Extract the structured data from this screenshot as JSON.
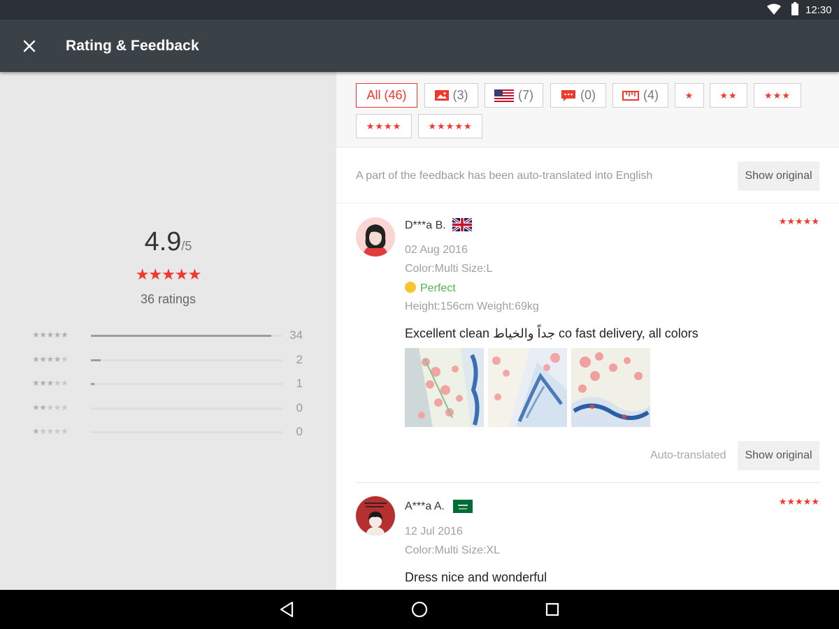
{
  "status_bar": {
    "time": "12:30",
    "icons": [
      "wifi-icon",
      "battery-icon"
    ]
  },
  "app_bar": {
    "title": "Rating & Feedback",
    "close_icon": "close-icon"
  },
  "summary": {
    "average": "4.9",
    "out_of": "/5",
    "stars": "★★★★★",
    "ratings_label": "36 ratings",
    "distribution": [
      {
        "stars": 5,
        "count": "34",
        "fraction": 0.94
      },
      {
        "stars": 4,
        "count": "2",
        "fraction": 0.05
      },
      {
        "stars": 3,
        "count": "1",
        "fraction": 0.02
      },
      {
        "stars": 2,
        "count": "0",
        "fraction": 0
      },
      {
        "stars": 1,
        "count": "0",
        "fraction": 0
      }
    ]
  },
  "filters": {
    "all": "All (46)",
    "photo_count": "(3)",
    "country_count": "(7)",
    "comment_count": "(0)",
    "size_count": "(4)",
    "one_star": "★",
    "two_star": "★★",
    "three_star": "★★★",
    "four_star": "★★★★",
    "five_star": "★★★★★"
  },
  "notice": {
    "text": "A part of the feedback has been auto-translated into English",
    "button": "Show original"
  },
  "reviews": [
    {
      "name": "D***a B.",
      "country_flag": "uk-flag",
      "stars": "★★★★★",
      "date": "02 Aug 2016",
      "variant": "Color:Multi Size:L",
      "fit": "Perfect",
      "body_measure": "Height:156cm Weight:69kg",
      "text": "Excellent clean جداً والخياط co fast delivery, all colors",
      "auto_label": "Auto-translated",
      "button": "Show original"
    },
    {
      "name": "A***a A.",
      "country_flag": "saudi-flag",
      "stars": "★★★★★",
      "date": "12 Jul 2016",
      "variant": "Color:Multi Size:XL",
      "text": "Dress nice and wonderful"
    }
  ],
  "nav_bar": {
    "icons": [
      "back-icon",
      "home-icon",
      "recents-icon"
    ]
  },
  "colors": {
    "accent": "#f2382d",
    "appbar": "#3b4247",
    "statusbar": "#2b3136",
    "panel": "#e8e8e8",
    "perfect": "#4db64d"
  }
}
